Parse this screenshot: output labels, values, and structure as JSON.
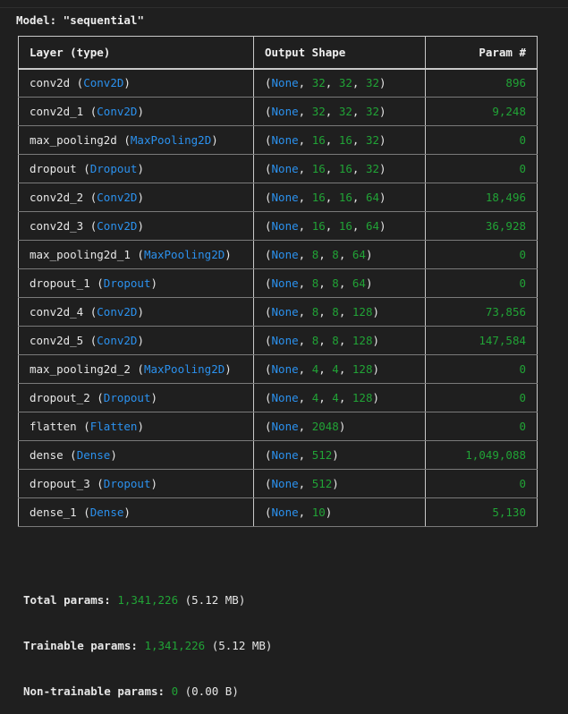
{
  "model_title": "Model: \"sequential\"",
  "headers": {
    "layer": "Layer (type)",
    "output_shape": "Output Shape",
    "param": "Param #"
  },
  "layers": [
    {
      "name": "conv2d",
      "type": "Conv2D",
      "shape": [
        "None",
        "32",
        "32",
        "32"
      ],
      "params": "896"
    },
    {
      "name": "conv2d_1",
      "type": "Conv2D",
      "shape": [
        "None",
        "32",
        "32",
        "32"
      ],
      "params": "9,248"
    },
    {
      "name": "max_pooling2d",
      "type": "MaxPooling2D",
      "shape": [
        "None",
        "16",
        "16",
        "32"
      ],
      "params": "0"
    },
    {
      "name": "dropout",
      "type": "Dropout",
      "shape": [
        "None",
        "16",
        "16",
        "32"
      ],
      "params": "0"
    },
    {
      "name": "conv2d_2",
      "type": "Conv2D",
      "shape": [
        "None",
        "16",
        "16",
        "64"
      ],
      "params": "18,496"
    },
    {
      "name": "conv2d_3",
      "type": "Conv2D",
      "shape": [
        "None",
        "16",
        "16",
        "64"
      ],
      "params": "36,928"
    },
    {
      "name": "max_pooling2d_1",
      "type": "MaxPooling2D",
      "shape": [
        "None",
        "8",
        "8",
        "64"
      ],
      "params": "0"
    },
    {
      "name": "dropout_1",
      "type": "Dropout",
      "shape": [
        "None",
        "8",
        "8",
        "64"
      ],
      "params": "0"
    },
    {
      "name": "conv2d_4",
      "type": "Conv2D",
      "shape": [
        "None",
        "8",
        "8",
        "128"
      ],
      "params": "73,856"
    },
    {
      "name": "conv2d_5",
      "type": "Conv2D",
      "shape": [
        "None",
        "8",
        "8",
        "128"
      ],
      "params": "147,584"
    },
    {
      "name": "max_pooling2d_2",
      "type": "MaxPooling2D",
      "shape": [
        "None",
        "4",
        "4",
        "128"
      ],
      "params": "0"
    },
    {
      "name": "dropout_2",
      "type": "Dropout",
      "shape": [
        "None",
        "4",
        "4",
        "128"
      ],
      "params": "0"
    },
    {
      "name": "flatten",
      "type": "Flatten",
      "shape": [
        "None",
        "2048"
      ],
      "params": "0"
    },
    {
      "name": "dense",
      "type": "Dense",
      "shape": [
        "None",
        "512"
      ],
      "params": "1,049,088"
    },
    {
      "name": "dropout_3",
      "type": "Dropout",
      "shape": [
        "None",
        "512"
      ],
      "params": "0"
    },
    {
      "name": "dense_1",
      "type": "Dense",
      "shape": [
        "None",
        "10"
      ],
      "params": "5,130"
    }
  ],
  "totals": {
    "total_label": "Total params: ",
    "total_value": "1,341,226",
    "total_size": " (5.12 MB)",
    "trainable_label": "Trainable params: ",
    "trainable_value": "1,341,226",
    "trainable_size": " (5.12 MB)",
    "non_trainable_label": "Non-trainable params: ",
    "non_trainable_value": "0",
    "non_trainable_size": " (0.00 B)"
  },
  "colors": {
    "background": "#1f1f1f",
    "text": "#e6e6e6",
    "type_blue": "#2b91ee",
    "number_green": "#21a336",
    "border": "#c8c8c8"
  }
}
